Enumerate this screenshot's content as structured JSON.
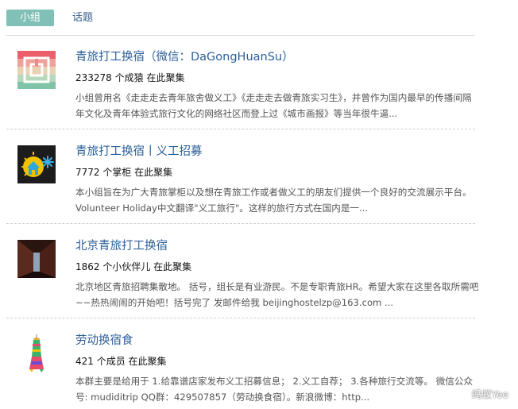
{
  "tabs": {
    "groups_label": "小组",
    "topics_label": "话题"
  },
  "groups": [
    {
      "title": "青旅打工换宿（微信：DaGongHuanSu）",
      "count": "233278 个成猿 在此聚集",
      "description": "小组曾用名《走走走去青年旅舍做义工》《走走走去做青旅实习生》，并曾作为国内最早的传播间隔年文化及青年体验式旅行文化的网络社区而登上过《城市画报》等当年很牛逼..."
    },
    {
      "title": "青旅打工换宿丨义工招募",
      "count": "7772 个掌柜 在此聚集",
      "description": "本小组旨在为广大青旅掌柜以及想在青旅工作或者做义工的朋友们提供一个良好的交流展示平台。 Volunteer Holiday中文翻译\"义工旅行\"。这样的旅行方式在国内是一..."
    },
    {
      "title": "北京青旅打工换宿",
      "count": "1862 个小伙伴儿 在此聚集",
      "description": "北京地区青旅招聘集散地。 括号，组长是有业游民。不是专职青旅HR。希望大家在这里各取所需吧~~热热闹闹的开始吧！括号完了 发邮件给我 beijinghostelzp@163.com ..."
    },
    {
      "title": "劳动换宿食",
      "count": "421 个成员 在此聚集",
      "description": "本群主要是给用于 1.给靠谱店家发布义工招募信息； 2.义工自荐； 3.各种旅行交流等。 微信公众号: mudiditrip QQ群：429507857（劳动换食宿）。新浪微博：http..."
    }
  ],
  "watermark": {
    "text": "蚂蚁Yee"
  },
  "colors": {
    "tab_active_bg": "#80c0b6",
    "link": "#2c5f97"
  }
}
